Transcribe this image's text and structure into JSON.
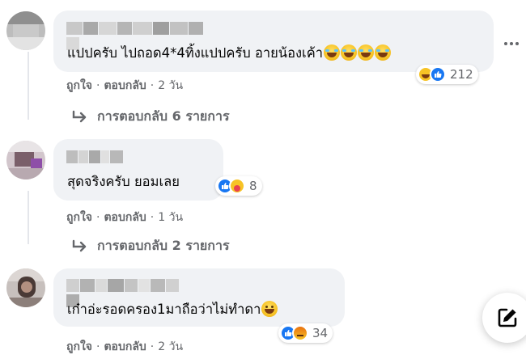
{
  "comments": [
    {
      "text": "แปปครับ ไปถอด4*4ทิ้งแปปครับ อายน้องเค้า",
      "emojis": [
        "rolling-on-floor-laughing",
        "rolling-on-floor-laughing",
        "rolling-on-floor-laughing",
        "rolling-on-floor-laughing"
      ],
      "reactions": [
        "haha",
        "like"
      ],
      "reaction_count": "212",
      "like_label": "ถูกใจ",
      "reply_label": "ตอบกลับ",
      "time": "2 วัน",
      "replies_link": "การตอบกลับ 6 รายการ"
    },
    {
      "text": "สุดจริงครับ ยอมเลย",
      "emojis": [],
      "reactions": [
        "like",
        "care"
      ],
      "reaction_count": "8",
      "like_label": "ถูกใจ",
      "reply_label": "ตอบกลับ",
      "time": "1 วัน",
      "replies_link": "การตอบกลับ 2 รายการ"
    },
    {
      "text": "เก๋าอ่ะรอดครอง1มาถือว่าไม่ทำดา",
      "emojis": [
        "grinning-face"
      ],
      "reactions": [
        "like",
        "angry"
      ],
      "reaction_count": "34",
      "like_label": "ถูกใจ",
      "reply_label": "ตอบกลับ",
      "time": "2 วัน"
    }
  ],
  "icons": {
    "more": "more-horizontal-icon",
    "compose": "edit-compose-icon",
    "reply_arrow": "reply-arrow-icon"
  },
  "colors": {
    "bubble": "#f0f2f5",
    "secondary_text": "#65676b",
    "like_blue": "#1877f2"
  }
}
